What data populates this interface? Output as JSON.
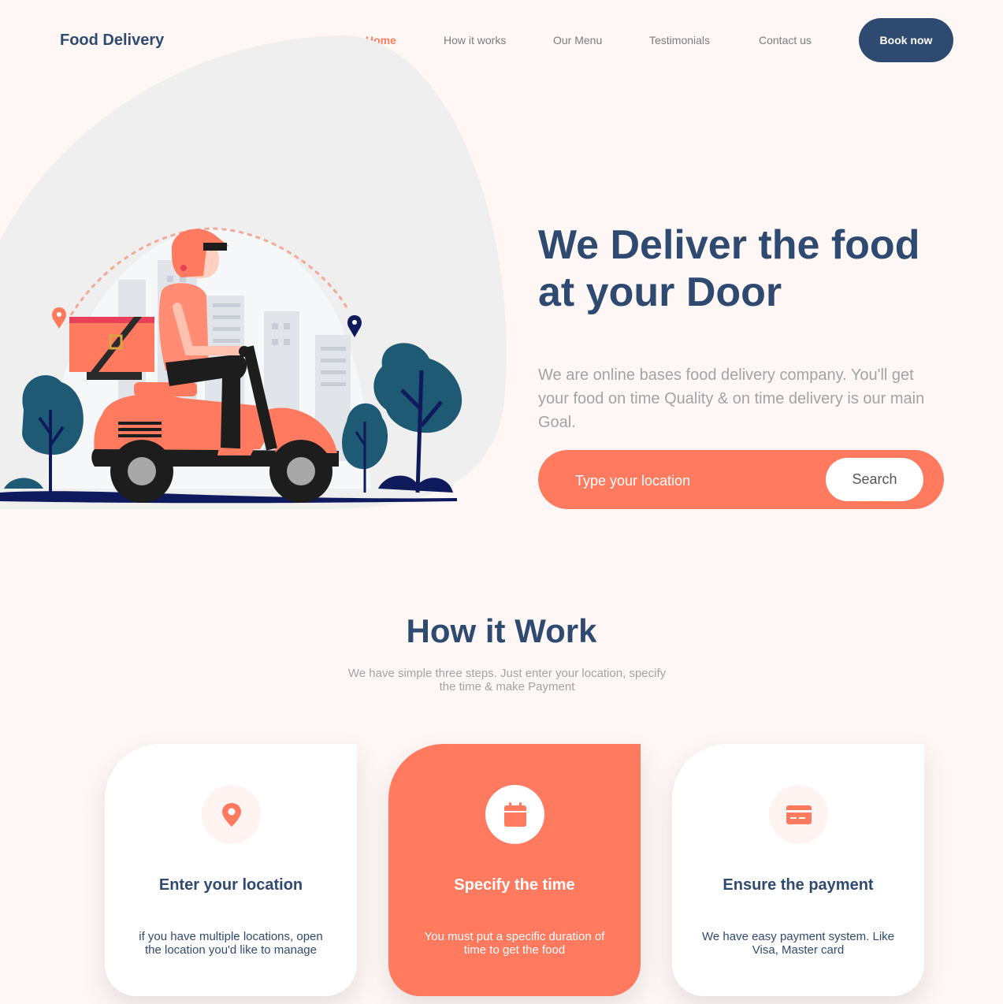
{
  "header": {
    "logo": "Food Delivery",
    "nav": [
      "Home",
      "How it works",
      "Our Menu",
      "Testimonials",
      "Contact us"
    ],
    "active_nav": "Home",
    "cta": "Book now"
  },
  "hero": {
    "title_line1": "We Deliver the food",
    "title_line2": "at your Door",
    "description": "We are online bases food delivery company. You'll get your food on time Quality & on time delivery is our main Goal.",
    "search_placeholder": "Type your location",
    "search_button": "Search"
  },
  "how_it_works": {
    "title": "How it Work",
    "subtitle": "We have simple three steps. Just enter your location, specify the time & make Payment",
    "cards": [
      {
        "icon": "location-pin-icon",
        "title": "Enter your location",
        "text": "if you have multiple locations, open the location you'd like to manage"
      },
      {
        "icon": "calendar-icon",
        "title": "Specify the time",
        "text": "You must put a specific duration of time to get the food"
      },
      {
        "icon": "credit-card-icon",
        "title": "Ensure the payment",
        "text": "We have easy payment system. Like Visa, Master card"
      }
    ]
  },
  "colors": {
    "background": "#fff7f5",
    "accent": "#ff7a5f",
    "navy": "#2f4a70",
    "muted": "#a3a3a3"
  }
}
